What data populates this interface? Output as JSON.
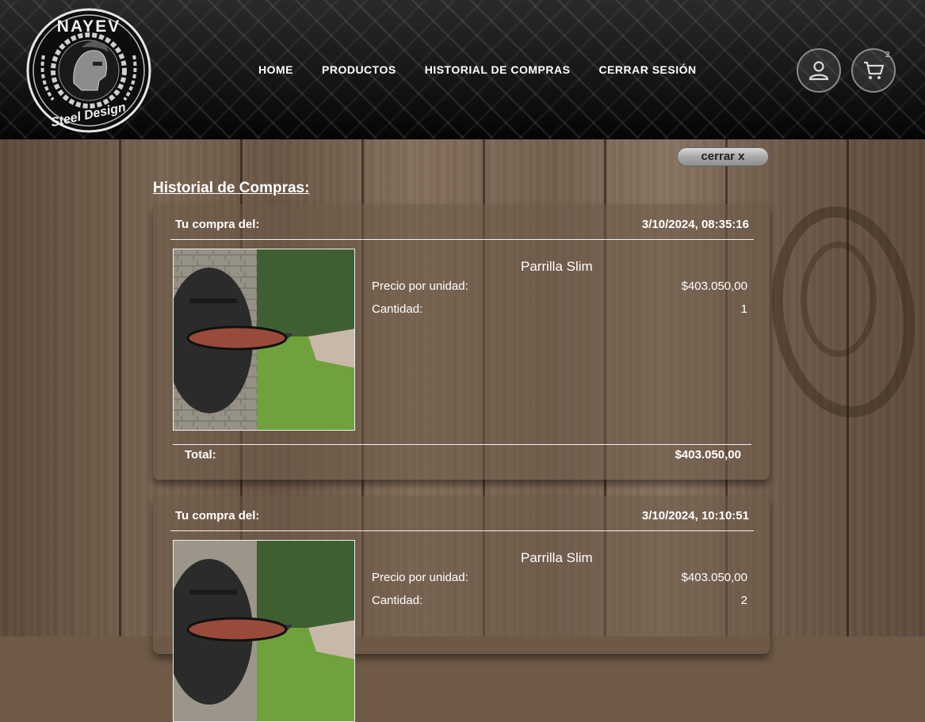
{
  "brand": {
    "logo_top": "NAYEV",
    "logo_bottom": "Steel Design"
  },
  "nav": {
    "items": [
      {
        "label": "HOME"
      },
      {
        "label": "PRODUCTOS"
      },
      {
        "label": "HISTORIAL DE COMPRAS"
      },
      {
        "label": "CERRAR SESIÓN"
      }
    ]
  },
  "header_icons": {
    "user_icon": "user-icon",
    "cart_icon": "cart-icon",
    "cart_count": "2"
  },
  "close_button": {
    "label": "cerrar x"
  },
  "page": {
    "title": "Historial de Compras:"
  },
  "purchases": [
    {
      "label": "Tu compra del:",
      "date": "3/10/2024, 08:35:16",
      "product_name": "Parrilla Slim",
      "unit_price_label": "Precio por unidad:",
      "unit_price": "$403.050,00",
      "quantity_label": "Cantidad:",
      "quantity": "1",
      "total_label": "Total:",
      "total": "$403.050,00"
    },
    {
      "label": "Tu compra del:",
      "date": "3/10/2024, 10:10:51",
      "product_name": "Parrilla Slim",
      "unit_price_label": "Precio por unidad:",
      "unit_price": "$403.050,00",
      "quantity_label": "Cantidad:",
      "quantity": "2"
    }
  ]
}
